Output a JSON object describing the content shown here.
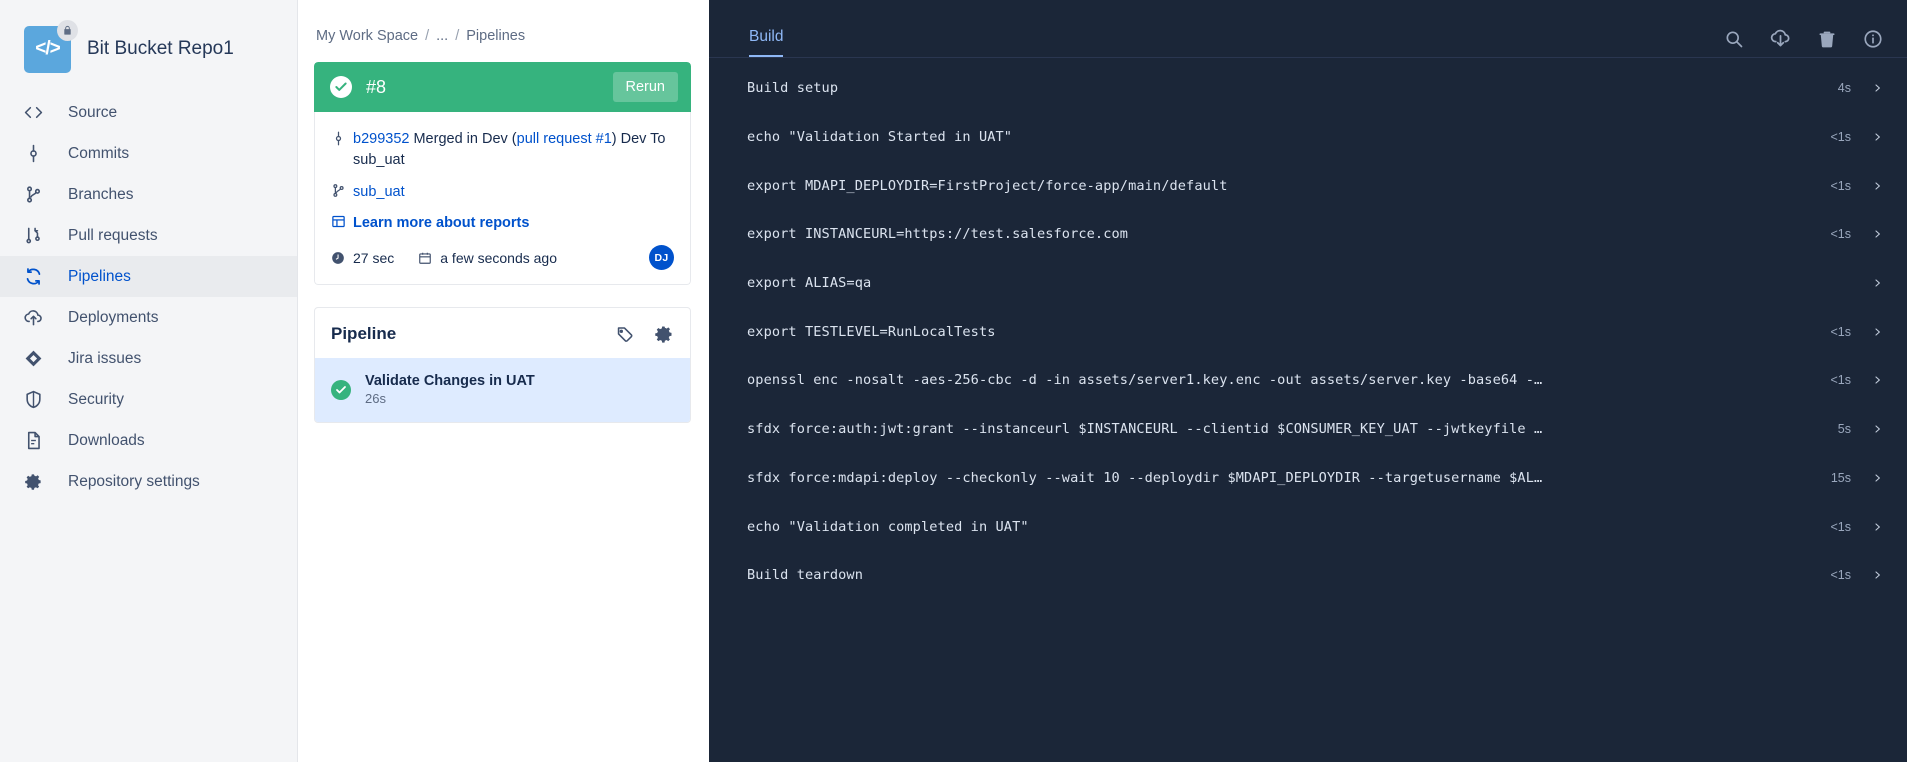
{
  "sidebar": {
    "repo": {
      "name": "Bit Bucket Repo1",
      "avatar_glyph": "</>",
      "avatar_color": "#5ba7dd",
      "lock_icon": "lock-icon"
    },
    "items": [
      {
        "label": "Source",
        "icon": "code-brackets-icon",
        "active": false
      },
      {
        "label": "Commits",
        "icon": "commit-icon",
        "active": false
      },
      {
        "label": "Branches",
        "icon": "branch-icon",
        "active": false
      },
      {
        "label": "Pull requests",
        "icon": "pull-request-icon",
        "active": false
      },
      {
        "label": "Pipelines",
        "icon": "pipelines-refresh-icon",
        "active": true
      },
      {
        "label": "Deployments",
        "icon": "cloud-upload-icon",
        "active": false
      },
      {
        "label": "Jira issues",
        "icon": "jira-diamond-icon",
        "active": false
      },
      {
        "label": "Security",
        "icon": "shield-icon",
        "active": false
      },
      {
        "label": "Downloads",
        "icon": "document-icon",
        "active": false
      },
      {
        "label": "Repository settings",
        "icon": "gear-icon",
        "active": false
      }
    ]
  },
  "breadcrumb": {
    "workspace": "My Work Space",
    "sep1": "/",
    "ellipsis": "...",
    "sep2": "/",
    "current": "Pipelines"
  },
  "build": {
    "status_icon": "check-circle-icon",
    "number": "#8",
    "rerun_label": "Rerun",
    "header_color": "#36b37e",
    "commit": {
      "icon": "commit-icon",
      "hash": "b299352",
      "text_before": " Merged in Dev (",
      "pr_link": "pull request #1",
      "text_after": ") Dev To sub_uat"
    },
    "branch": {
      "icon": "branch-icon",
      "name": "sub_uat"
    },
    "reports": {
      "icon": "report-table-icon",
      "label": "Learn more about reports"
    },
    "duration": {
      "icon": "clock-icon",
      "value": "27 sec"
    },
    "timestamp": {
      "icon": "calendar-icon",
      "value": "a few seconds ago"
    },
    "avatar": {
      "initials": "DJ",
      "color": "#0052cc"
    }
  },
  "pipeline": {
    "title": "Pipeline",
    "actions": [
      {
        "name": "tag-icon",
        "label": "tag"
      },
      {
        "name": "gear-icon",
        "label": "settings"
      }
    ],
    "steps": [
      {
        "name": "Validate Changes in UAT",
        "duration": "26s",
        "status_icon": "check-circle-icon",
        "selected": true
      }
    ]
  },
  "log_panel": {
    "tab": "Build",
    "tab_color": "#8fb8f6",
    "background": "#1b2638",
    "icons": [
      {
        "name": "search-icon"
      },
      {
        "name": "cloud-download-icon"
      },
      {
        "name": "trash-icon"
      },
      {
        "name": "info-icon"
      }
    ],
    "lines": [
      {
        "cmd": "Build setup",
        "time": "4s"
      },
      {
        "cmd": "echo \"Validation Started in UAT\"",
        "time": "<1s"
      },
      {
        "cmd": "export MDAPI_DEPLOYDIR=FirstProject/force-app/main/default",
        "time": "<1s"
      },
      {
        "cmd": "export INSTANCEURL=https://test.salesforce.com",
        "time": "<1s"
      },
      {
        "cmd": "export ALIAS=qa",
        "time": ""
      },
      {
        "cmd": "export TESTLEVEL=RunLocalTests",
        "time": "<1s"
      },
      {
        "cmd": "openssl enc -nosalt -aes-256-cbc -d -in assets/server1.key.enc -out assets/server.key -base64 -…",
        "time": "<1s"
      },
      {
        "cmd": "sfdx force:auth:jwt:grant --instanceurl $INSTANCEURL --clientid $CONSUMER_KEY_UAT --jwtkeyfile …",
        "time": "5s"
      },
      {
        "cmd": "sfdx force:mdapi:deploy --checkonly --wait 10 --deploydir $MDAPI_DEPLOYDIR --targetusername $AL…",
        "time": "15s"
      },
      {
        "cmd": "echo \"Validation completed in UAT\"",
        "time": "<1s"
      },
      {
        "cmd": "Build teardown",
        "time": "<1s"
      }
    ]
  }
}
